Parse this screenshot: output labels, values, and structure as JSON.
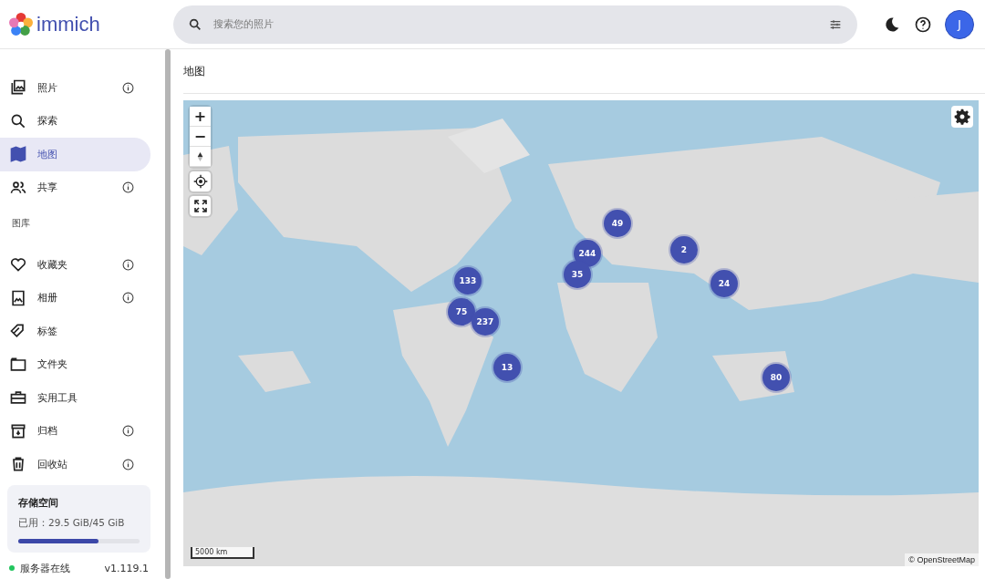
{
  "app": {
    "name": "immich"
  },
  "search": {
    "placeholder": "搜索您的照片"
  },
  "header": {
    "avatar": "J"
  },
  "sidebar": {
    "items": [
      {
        "kind": "photos",
        "label": "照片",
        "selected": false,
        "info": true
      },
      {
        "kind": "explore",
        "label": "探索",
        "selected": false,
        "info": false
      },
      {
        "kind": "map",
        "label": "地图",
        "selected": true,
        "info": false
      },
      {
        "kind": "sharing",
        "label": "共享",
        "selected": false,
        "info": true
      }
    ],
    "library_heading": "图库",
    "library_items": [
      {
        "kind": "favorites",
        "label": "收藏夹",
        "selected": false,
        "info": true
      },
      {
        "kind": "albums",
        "label": "相册",
        "selected": false,
        "info": true
      },
      {
        "kind": "tags",
        "label": "标签",
        "selected": false,
        "info": false
      },
      {
        "kind": "folders",
        "label": "文件夹",
        "selected": false,
        "info": false
      },
      {
        "kind": "utilities",
        "label": "实用工具",
        "selected": false,
        "info": false
      },
      {
        "kind": "archive",
        "label": "归档",
        "selected": false,
        "info": true
      },
      {
        "kind": "trash",
        "label": "回收站",
        "selected": false,
        "info": true
      }
    ],
    "storage": {
      "title": "存储空间",
      "usage": "已用：29.5 GiB/45 GiB",
      "level": 0.66
    },
    "server": {
      "status": "服务器在线",
      "online": true,
      "version": "v1.119.1"
    }
  },
  "page": {
    "title": "地图"
  },
  "map": {
    "kind": "picture",
    "zoom_in": "+",
    "zoom_out": "−",
    "scale": "5000 km",
    "attribution": "© OpenStreetMap",
    "clusters": [
      "49",
      "244",
      "2",
      "133",
      "35",
      "24",
      "75",
      "237",
      "13",
      "80"
    ]
  }
}
